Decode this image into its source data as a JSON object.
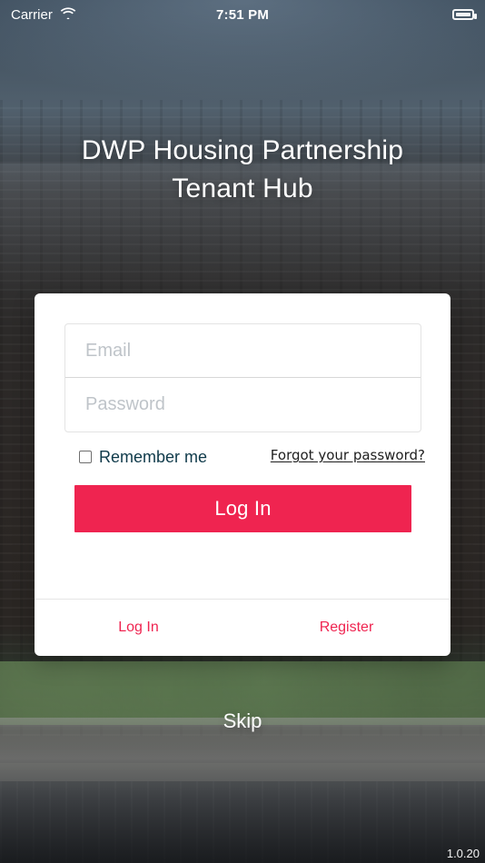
{
  "status_bar": {
    "carrier": "Carrier",
    "time": "7:51 PM",
    "wifi_icon": "wifi-icon",
    "battery_icon": "battery-icon"
  },
  "header": {
    "title_line1": "DWP Housing Partnership",
    "title_line2": "Tenant Hub"
  },
  "login_form": {
    "email_placeholder": "Email",
    "password_placeholder": "Password",
    "remember_me_label": "Remember me",
    "forgot_password_label": "Forgot your password?",
    "login_button_label": "Log In"
  },
  "card_tabs": {
    "login_label": "Log In",
    "register_label": "Register"
  },
  "footer": {
    "skip_label": "Skip",
    "version": "1.0.20"
  },
  "colors": {
    "accent": "#EF2450",
    "text_dark": "#1E1E1E",
    "remember_text": "#0F3A4A"
  }
}
